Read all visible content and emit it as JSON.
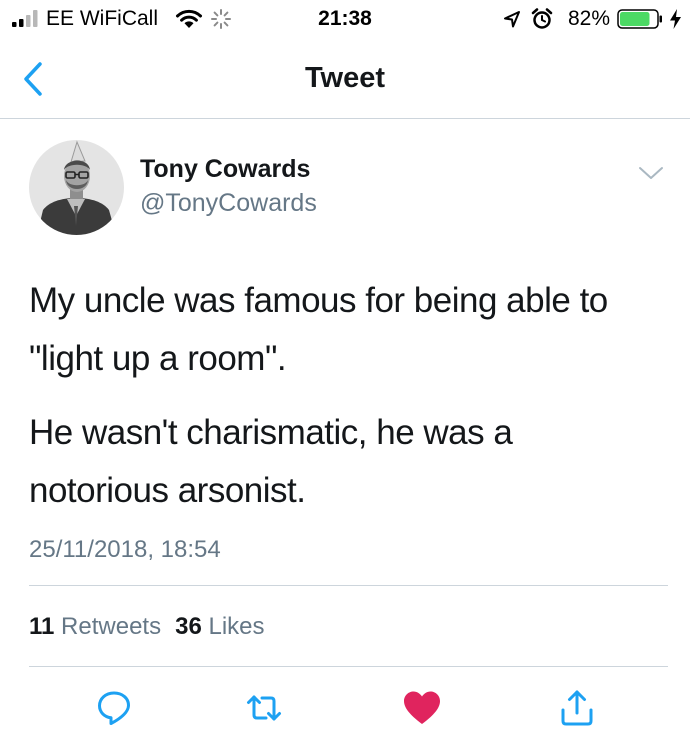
{
  "status_bar": {
    "carrier": "EE WiFiCall",
    "time": "21:38",
    "battery_percent": "82%",
    "battery_level": 0.82,
    "icons": [
      "signal-icon",
      "wifi-icon",
      "activity-spinner-icon",
      "location-icon",
      "alarm-icon",
      "battery-icon",
      "charging-icon"
    ]
  },
  "nav": {
    "title": "Tweet",
    "back_icon": "chevron-left-icon"
  },
  "tweet": {
    "author_name": "Tony Cowards",
    "author_handle": "@TonyCowards",
    "paragraph1_line1": "My uncle was famous for being able to",
    "paragraph1_line2": "\"light up a room\".",
    "paragraph2_line1": "He wasn't charismatic, he was a",
    "paragraph2_line2": "notorious arsonist.",
    "timestamp": "25/11/2018, 18:54",
    "retweets_count": "11",
    "retweets_label": "Retweets",
    "likes_count": "36",
    "likes_label": "Likes"
  },
  "actions": {
    "reply_icon": "reply-icon",
    "retweet_icon": "retweet-icon",
    "like_icon": "heart-icon",
    "share_icon": "share-icon",
    "liked": true
  },
  "colors": {
    "accent": "#1da1f2",
    "like": "#e0245e",
    "secondary_text": "#657786",
    "primary_text": "#14171a",
    "divider": "#cdd5dc",
    "battery_fill": "#4cd964"
  }
}
